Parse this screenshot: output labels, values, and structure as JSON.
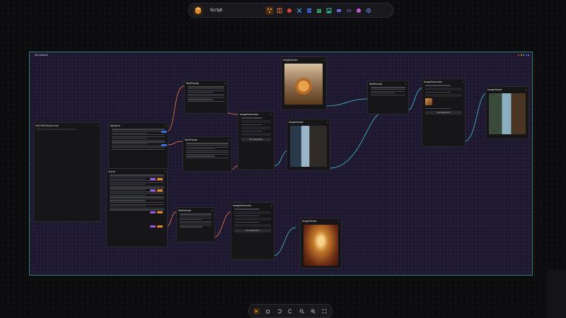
{
  "toolbar": {
    "title": "Script",
    "icons": [
      "logo-icon",
      "layout-icon",
      "record-icon",
      "tools-icon",
      "grid-icon",
      "users-icon",
      "image-icon",
      "video-icon",
      "3d-icon",
      "palette-icon",
      "gear-icon"
    ]
  },
  "board": {
    "label": "Storyboard"
  },
  "nodes": {
    "text_a": {
      "title": "TextPrompt"
    },
    "text_b": {
      "title": "TextPrompt"
    },
    "text_c": {
      "title": "TextPrompt"
    },
    "text_d": {
      "title": "TextPrompt"
    },
    "image_gen_a": {
      "title": "ImageGenerator",
      "btn": "Run Generation"
    },
    "image_gen_b": {
      "title": "ImageGenerator",
      "btn": "Run Generation"
    },
    "image_gen_c": {
      "title": "ImageGenerator",
      "btn": "Run Generation"
    },
    "viewer_a": {
      "title": "ImageViewer"
    },
    "viewer_b": {
      "title": "ImageViewer"
    },
    "viewer_c": {
      "title": "ImageViewer"
    },
    "viewer_d": {
      "title": "ImageViewer"
    },
    "story": {
      "title": "Storyline"
    },
    "scene": {
      "title": "Scene"
    },
    "file": {
      "title": "SVCOSEO/Scene.md"
    }
  },
  "bottombar": {
    "icons": [
      "pointer-icon",
      "hand-icon",
      "undo-icon",
      "redo-icon",
      "zoom-in-icon",
      "zoom-out-icon",
      "fullscreen-icon"
    ]
  },
  "colors": {
    "accent": "#f08a24",
    "board_border": "#2f7d72",
    "board_bg": "#1d1730"
  }
}
